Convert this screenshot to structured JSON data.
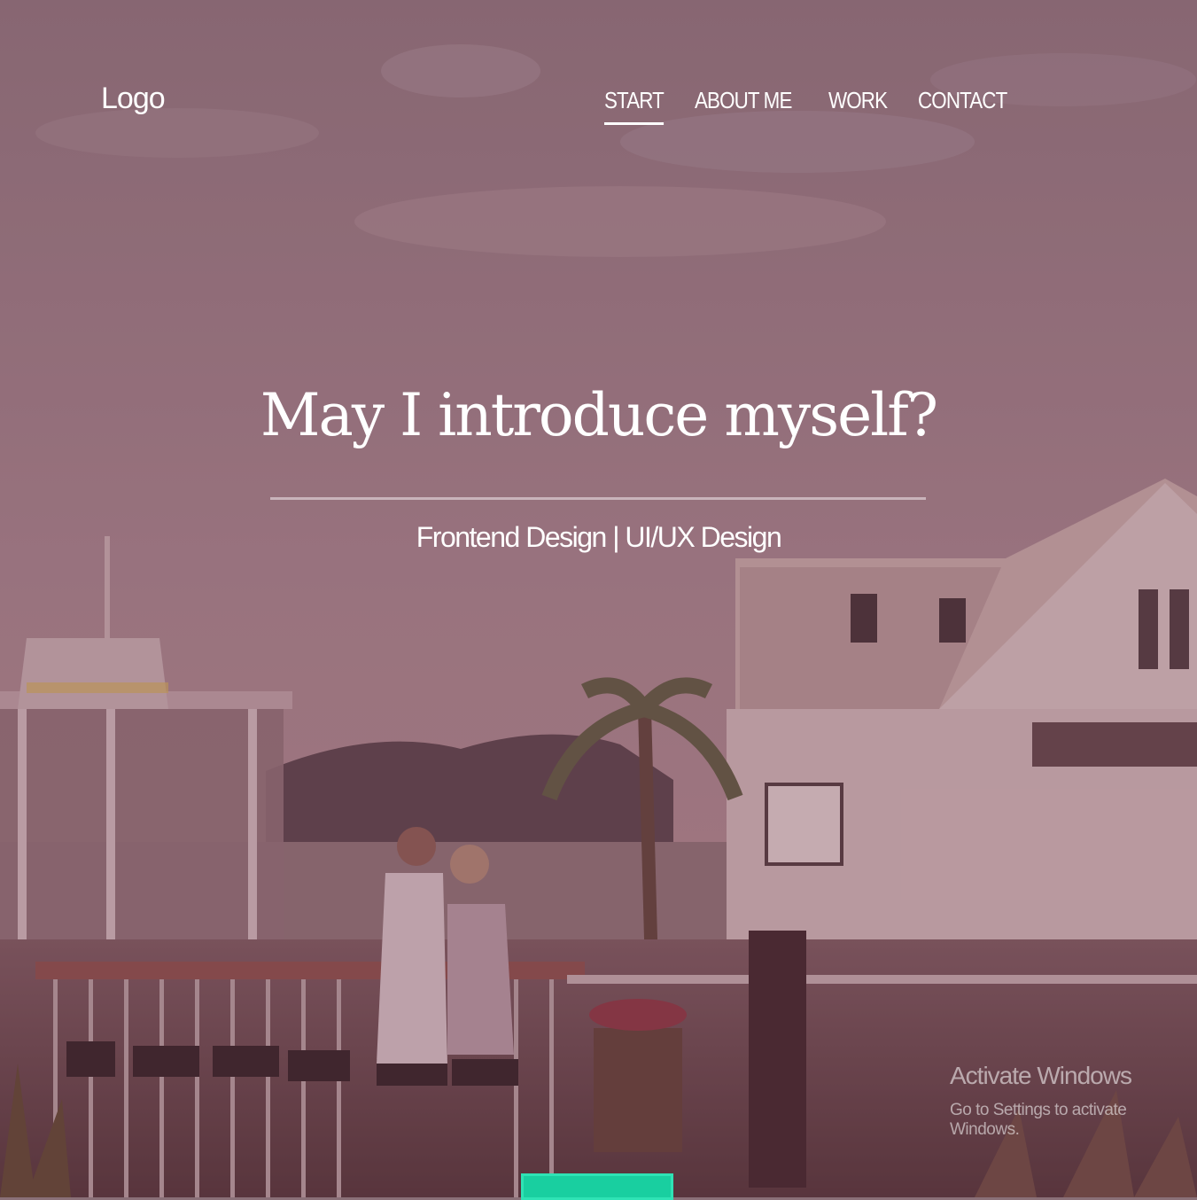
{
  "header": {
    "logo": "Logo",
    "nav": [
      {
        "label": "START",
        "active": true
      },
      {
        "label": "ABOUT ME",
        "active": false
      },
      {
        "label": "WORK",
        "active": false
      },
      {
        "label": "CONTACT",
        "active": false
      }
    ]
  },
  "hero": {
    "title": "May I introduce myself?",
    "subtitle": "Frontend Design | UI/UX Design"
  },
  "watermark": {
    "title": "Activate Windows",
    "subtitle": "Go to Settings to activate Windows."
  },
  "colors": {
    "overlay": "#8a5a6a",
    "accent": "#19cfa0",
    "text": "#ffffff"
  }
}
